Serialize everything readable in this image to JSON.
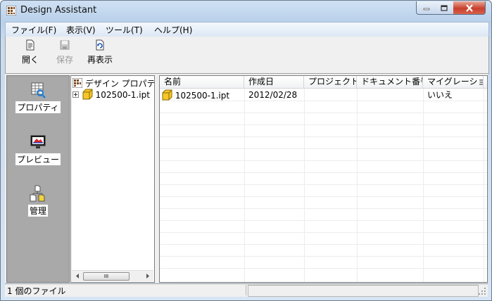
{
  "window": {
    "title": "Design Assistant"
  },
  "menu": [
    {
      "label": "ファイル(F)"
    },
    {
      "label": "表示(V)"
    },
    {
      "label": "ツール(T)"
    },
    {
      "label": "ヘルプ(H)"
    }
  ],
  "toolbar": {
    "open_label": "開く",
    "save_label": "保存",
    "refresh_label": "再表示"
  },
  "nav": {
    "properties_label": "プロパティ",
    "preview_label": "プレビュー",
    "manage_label": "管理"
  },
  "tree": {
    "root_label": "デザイン プロパティ表",
    "child_label": "102500-1.ipt",
    "scroll_thumb": "III"
  },
  "list": {
    "columns": [
      "名前",
      "作成日",
      "プロジェクト",
      "ドキュメント番号",
      "マイグレーショ..."
    ],
    "rows": [
      {
        "name": "102500-1.ipt",
        "created": "2012/02/28",
        "project": "",
        "doc_number": "",
        "migration": "いいえ"
      }
    ]
  },
  "status": {
    "file_count": "1 個のファイル"
  }
}
